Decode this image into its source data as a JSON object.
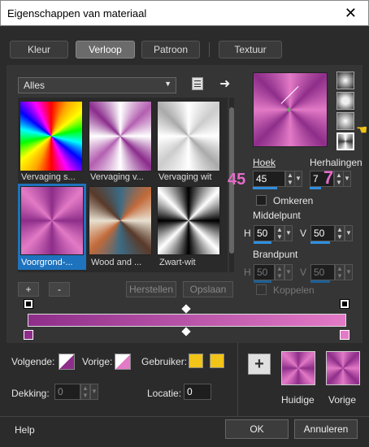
{
  "window": {
    "title": "Eigenschappen van materiaal",
    "close": "✕"
  },
  "tabs": [
    "Kleur",
    "Verloop",
    "Patroon",
    "Textuur"
  ],
  "gallery": {
    "selected": "Alles",
    "items": [
      {
        "label": "Vervaging s..."
      },
      {
        "label": "Vervaging v..."
      },
      {
        "label": "Vervaging wit"
      },
      {
        "label": "Voorgrond-..."
      },
      {
        "label": "Wood and ..."
      },
      {
        "label": "Zwart-wit"
      }
    ]
  },
  "gallery_buttons": {
    "add": "+",
    "remove": "-",
    "reset": "Herstellen",
    "save": "Opslaan"
  },
  "angle": {
    "label": "Hoek",
    "value": "45",
    "annotation": "45"
  },
  "repeats": {
    "label": "Herhalingen",
    "value": "7",
    "annotation": "7"
  },
  "invert": {
    "label": "Omkeren"
  },
  "center": {
    "label": "Middelpunt",
    "h_label": "H",
    "h_value": "50",
    "v_label": "V",
    "v_value": "50"
  },
  "focal": {
    "label": "Brandpunt",
    "h_label": "H",
    "h_value": "50",
    "v_label": "V",
    "v_value": "50"
  },
  "link": {
    "label": "Koppelen"
  },
  "bottom": {
    "next_label": "Volgende:",
    "prev_label": "Vorige:",
    "user_label": "Gebruiker:",
    "user_color": "#f2c318",
    "opacity_label": "Dekking:",
    "opacity_value": "0",
    "location_label": "Locatie:",
    "location_value": "0",
    "add": "+",
    "current_label": "Huidige",
    "previous_label": "Vorige"
  },
  "footer": {
    "help": "Help",
    "ok": "OK",
    "cancel": "Annuleren"
  },
  "colors": {
    "accent": "#2e8fe0",
    "gradient_start": "#8e2e8a",
    "gradient_end": "#e37ac6",
    "annot": "#e56bc9"
  }
}
